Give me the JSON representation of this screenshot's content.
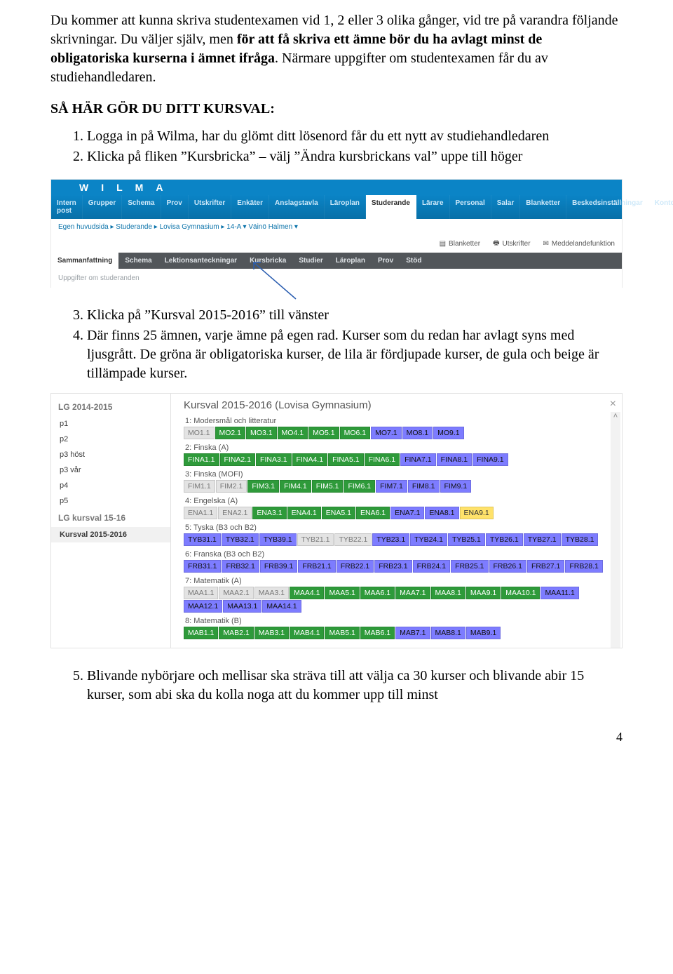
{
  "para1": {
    "a": "Du kommer att kunna skriva studentexamen vid 1, 2 eller 3 olika gånger, vid tre på varandra följande skrivningar. Du väljer själv, men ",
    "b": "för att få skriva ett ämne bör du ha avlagt minst de obligatoriska kurserna i ämnet ifråga",
    "c": ". Närmare uppgifter om studentexamen får du av studiehandledaren."
  },
  "heading": "SÅ HÄR GÖR DU DITT KURSVAL:",
  "steps_a": [
    "Logga in på Wilma, har du glömt ditt lösenord får du ett nytt av studiehandledaren",
    "Klicka på fliken ”Kursbricka” – välj ”Ändra kursbrickans val” uppe till höger"
  ],
  "steps_b": [
    "Klicka på ”Kursval 2015-2016” till vänster",
    "Där finns 25 ämnen, varje ämne på egen rad. Kurser som du redan har avlagt syns med ljusgrått. De gröna är obligatoriska kurser, de lila är fördjupade kurser, de gula och beige är tillämpade kurser."
  ],
  "step5": "Blivande nybörjare och mellisar ska sträva till att välja ca 30 kurser och blivande abir 15 kurser, som abi ska du kolla noga att du kommer upp till minst",
  "page_number": "4",
  "shot1": {
    "logo": "WILMA",
    "tabs": [
      "Intern post",
      "Grupper",
      "Schema",
      "Prov",
      "Utskrifter",
      "Enkäter",
      "Anslagstavla",
      "Läroplan",
      "Studerande",
      "Lärare",
      "Personal",
      "Salar",
      "Blanketter",
      "Beskedsinställningar",
      "Kontoinställnin"
    ],
    "active_tab": "Studerande",
    "crumbs": "Egen huvudsida ▸ Studerande ▸ Lovisa Gymnasium ▸ 14-A ▾  Väinö Halmen ▾",
    "tool_icons": {
      "blanketter": "Blanketter",
      "utskrifter": "Utskrifter",
      "medd": "Meddelandefunktion"
    },
    "subtabs": [
      "Sammanfattning",
      "Schema",
      "Lektionsanteckningar",
      "Kursbricka",
      "Studier",
      "Läroplan",
      "Prov",
      "Stöd"
    ],
    "greyline": "Uppgifter om studeranden"
  },
  "shot2": {
    "left_header1": "LG 2014-2015",
    "periods": [
      "p1",
      "p2",
      "p3 höst",
      "p3 vår",
      "p4",
      "p5"
    ],
    "left_header2": "LG kursval 15-16",
    "left_selected": "Kursval 2015-2016",
    "title": "Kursval 2015-2016 (Lovisa Gymnasium)",
    "close": "×",
    "subjects": [
      {
        "n": "1",
        "name": "Modersmål och litteratur",
        "chips": [
          {
            "t": "MO1.1",
            "c": "grey"
          },
          {
            "t": "MO2.1",
            "c": "green"
          },
          {
            "t": "MO3.1",
            "c": "green"
          },
          {
            "t": "MO4.1",
            "c": "green"
          },
          {
            "t": "MO5.1",
            "c": "green"
          },
          {
            "t": "MO6.1",
            "c": "green"
          },
          {
            "t": "MO7.1",
            "c": "purple"
          },
          {
            "t": "MO8.1",
            "c": "purple"
          },
          {
            "t": "MO9.1",
            "c": "purple"
          }
        ]
      },
      {
        "n": "2",
        "name": "Finska (A)",
        "chips": [
          {
            "t": "FINA1.1",
            "c": "green"
          },
          {
            "t": "FINA2.1",
            "c": "green"
          },
          {
            "t": "FINA3.1",
            "c": "green"
          },
          {
            "t": "FINA4.1",
            "c": "green"
          },
          {
            "t": "FINA5.1",
            "c": "green"
          },
          {
            "t": "FINA6.1",
            "c": "green"
          },
          {
            "t": "FINA7.1",
            "c": "purple"
          },
          {
            "t": "FINA8.1",
            "c": "purple"
          },
          {
            "t": "FINA9.1",
            "c": "purple"
          }
        ]
      },
      {
        "n": "3",
        "name": "Finska (MOFI)",
        "chips": [
          {
            "t": "FIM1.1",
            "c": "grey"
          },
          {
            "t": "FIM2.1",
            "c": "grey"
          },
          {
            "t": "FIM3.1",
            "c": "green"
          },
          {
            "t": "FIM4.1",
            "c": "green"
          },
          {
            "t": "FIM5.1",
            "c": "green"
          },
          {
            "t": "FIM6.1",
            "c": "green"
          },
          {
            "t": "FIM7.1",
            "c": "purple"
          },
          {
            "t": "FIM8.1",
            "c": "purple"
          },
          {
            "t": "FIM9.1",
            "c": "purple"
          }
        ]
      },
      {
        "n": "4",
        "name": "Engelska (A)",
        "chips": [
          {
            "t": "ENA1.1",
            "c": "grey"
          },
          {
            "t": "ENA2.1",
            "c": "grey"
          },
          {
            "t": "ENA3.1",
            "c": "green"
          },
          {
            "t": "ENA4.1",
            "c": "green"
          },
          {
            "t": "ENA5.1",
            "c": "green"
          },
          {
            "t": "ENA6.1",
            "c": "green"
          },
          {
            "t": "ENA7.1",
            "c": "purple"
          },
          {
            "t": "ENA8.1",
            "c": "purple"
          },
          {
            "t": "ENA9.1",
            "c": "yellow"
          }
        ]
      },
      {
        "n": "5",
        "name": "Tyska (B3 och B2)",
        "chips": [
          {
            "t": "TYB31.1",
            "c": "purple"
          },
          {
            "t": "TYB32.1",
            "c": "purple"
          },
          {
            "t": "TYB39.1",
            "c": "purple"
          },
          {
            "t": "TYB21.1",
            "c": "grey"
          },
          {
            "t": "TYB22.1",
            "c": "grey"
          },
          {
            "t": "TYB23.1",
            "c": "purple"
          },
          {
            "t": "TYB24.1",
            "c": "purple"
          },
          {
            "t": "TYB25.1",
            "c": "purple"
          },
          {
            "t": "TYB26.1",
            "c": "purple"
          },
          {
            "t": "TYB27.1",
            "c": "purple"
          },
          {
            "t": "TYB28.1",
            "c": "purple"
          }
        ]
      },
      {
        "n": "6",
        "name": "Franska (B3 och B2)",
        "chips": [
          {
            "t": "FRB31.1",
            "c": "purple"
          },
          {
            "t": "FRB32.1",
            "c": "purple"
          },
          {
            "t": "FRB39.1",
            "c": "purple"
          },
          {
            "t": "FRB21.1",
            "c": "purple"
          },
          {
            "t": "FRB22.1",
            "c": "purple"
          },
          {
            "t": "FRB23.1",
            "c": "purple"
          },
          {
            "t": "FRB24.1",
            "c": "purple"
          },
          {
            "t": "FRB25.1",
            "c": "purple"
          },
          {
            "t": "FRB26.1",
            "c": "purple"
          },
          {
            "t": "FRB27.1",
            "c": "purple"
          },
          {
            "t": "FRB28.1",
            "c": "purple"
          }
        ]
      },
      {
        "n": "7",
        "name": "Matematik (A)",
        "chips": [
          {
            "t": "MAA1.1",
            "c": "grey"
          },
          {
            "t": "MAA2.1",
            "c": "grey"
          },
          {
            "t": "MAA3.1",
            "c": "grey"
          },
          {
            "t": "MAA4.1",
            "c": "green"
          },
          {
            "t": "MAA5.1",
            "c": "green"
          },
          {
            "t": "MAA6.1",
            "c": "green"
          },
          {
            "t": "MAA7.1",
            "c": "green"
          },
          {
            "t": "MAA8.1",
            "c": "green"
          },
          {
            "t": "MAA9.1",
            "c": "green"
          },
          {
            "t": "MAA10.1",
            "c": "green"
          },
          {
            "t": "MAA11.1",
            "c": "purple"
          },
          {
            "t": "MAA12.1",
            "c": "purple"
          },
          {
            "t": "MAA13.1",
            "c": "purple"
          },
          {
            "t": "MAA14.1",
            "c": "purple"
          }
        ]
      },
      {
        "n": "8",
        "name": "Matematik (B)",
        "chips": [
          {
            "t": "MAB1.1",
            "c": "green"
          },
          {
            "t": "MAB2.1",
            "c": "green"
          },
          {
            "t": "MAB3.1",
            "c": "green"
          },
          {
            "t": "MAB4.1",
            "c": "green"
          },
          {
            "t": "MAB5.1",
            "c": "green"
          },
          {
            "t": "MAB6.1",
            "c": "green"
          },
          {
            "t": "MAB7.1",
            "c": "purple"
          },
          {
            "t": "MAB8.1",
            "c": "purple"
          },
          {
            "t": "MAB9.1",
            "c": "purple"
          }
        ]
      }
    ]
  }
}
